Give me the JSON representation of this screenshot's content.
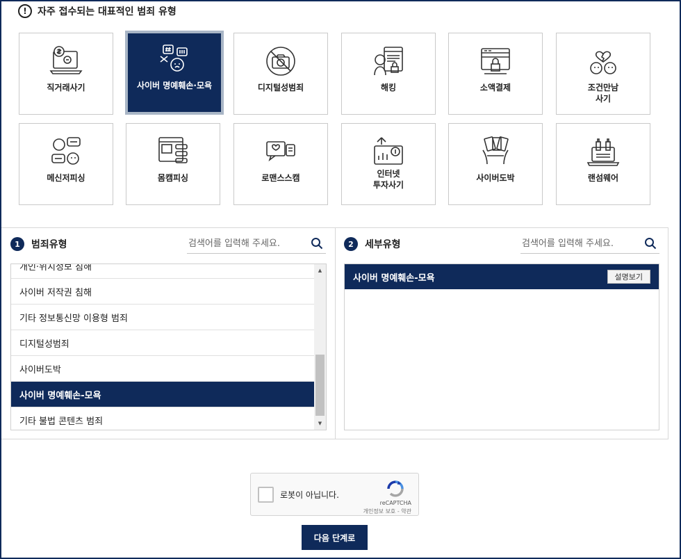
{
  "heading": {
    "icon": "exclamation-icon",
    "text": "자주 접수되는 대표적인 범죄 유형"
  },
  "tiles": [
    {
      "label": "직거래사기",
      "icon": "laptop-money-icon",
      "active": false
    },
    {
      "label": "사이버 명예훼손·모욕",
      "icon": "chat-insult-icon",
      "active": true
    },
    {
      "label": "디지털성범죄",
      "icon": "no-camera-icon",
      "active": false
    },
    {
      "label": "해킹",
      "icon": "hacker-icon",
      "active": false
    },
    {
      "label": "소액결제",
      "icon": "payment-lock-icon",
      "active": false
    },
    {
      "label": "조건만남\n사기",
      "icon": "broken-heart-icon",
      "active": false
    },
    {
      "label": "메신저피싱",
      "icon": "messenger-icon",
      "active": false
    },
    {
      "label": "몸캠피싱",
      "icon": "video-chat-icon",
      "active": false
    },
    {
      "label": "로맨스스캠",
      "icon": "romance-chat-icon",
      "active": false
    },
    {
      "label": "인터넷\n투자사기",
      "icon": "investment-icon",
      "active": false
    },
    {
      "label": "사이버도박",
      "icon": "cards-icon",
      "active": false
    },
    {
      "label": "랜섬웨어",
      "icon": "ransomware-icon",
      "active": false
    }
  ],
  "left_panel": {
    "number": "1",
    "title": "범죄유형",
    "search_placeholder": "검색어를 입력해 주세요.",
    "items": [
      {
        "label": "개인·위치정보 침해",
        "selected": false
      },
      {
        "label": "사이버 저작권 침해",
        "selected": false
      },
      {
        "label": "기타 정보통신망 이용형 범죄",
        "selected": false
      },
      {
        "label": "디지털성범죄",
        "selected": false
      },
      {
        "label": "사이버도박",
        "selected": false
      },
      {
        "label": "사이버 명예훼손-모욕",
        "selected": true
      },
      {
        "label": "기타 불법 콘텐츠 범죄",
        "selected": false
      }
    ]
  },
  "right_panel": {
    "number": "2",
    "title": "세부유형",
    "search_placeholder": "검색어를 입력해 주세요.",
    "selected_title": "사이버 명예훼손-모욕",
    "explain_button": "설명보기"
  },
  "captcha": {
    "label": "로봇이 아닙니다.",
    "brand": "reCAPTCHA",
    "links": "개인정보 보호 - 약관"
  },
  "next_button": "다음 단계로",
  "colors": {
    "navy": "#0f2a5a",
    "border": "#c9c9c9"
  }
}
